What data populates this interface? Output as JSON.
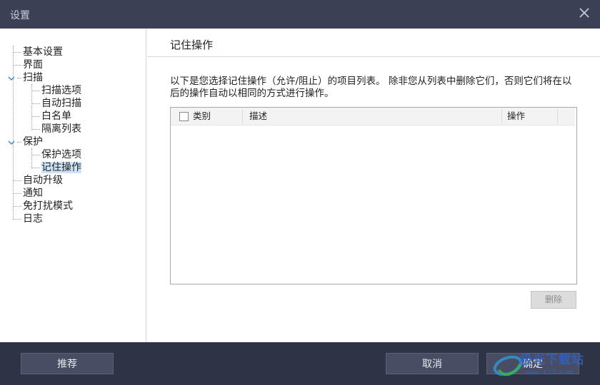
{
  "window": {
    "title": "设置"
  },
  "sidebar": {
    "items": [
      {
        "label": "基本设置"
      },
      {
        "label": "界面"
      },
      {
        "label": "扫描"
      },
      {
        "label": "扫描选项"
      },
      {
        "label": "自动扫描"
      },
      {
        "label": "白名单"
      },
      {
        "label": "隔离列表"
      },
      {
        "label": "保护"
      },
      {
        "label": "保护选项"
      },
      {
        "label": "记住操作",
        "selected": true
      },
      {
        "label": "自动升级"
      },
      {
        "label": "通知"
      },
      {
        "label": "免打扰模式"
      },
      {
        "label": "日志"
      }
    ]
  },
  "main": {
    "section_title": "记住操作",
    "description": "以下是您选择记住操作（允许/阻止）的项目列表。 除非您从列表中删除它们，否则它们将在以后的操作自动以相同的方式进行操作。",
    "table": {
      "columns": [
        "类别",
        "描述",
        "操作"
      ],
      "rows": []
    },
    "delete_label": "删除"
  },
  "footer": {
    "recommend_label": "推荐",
    "cancel_label": "取消",
    "ok_label": "确定"
  },
  "watermark": {
    "text": "极光下载站",
    "url": "www.xz7.com"
  }
}
